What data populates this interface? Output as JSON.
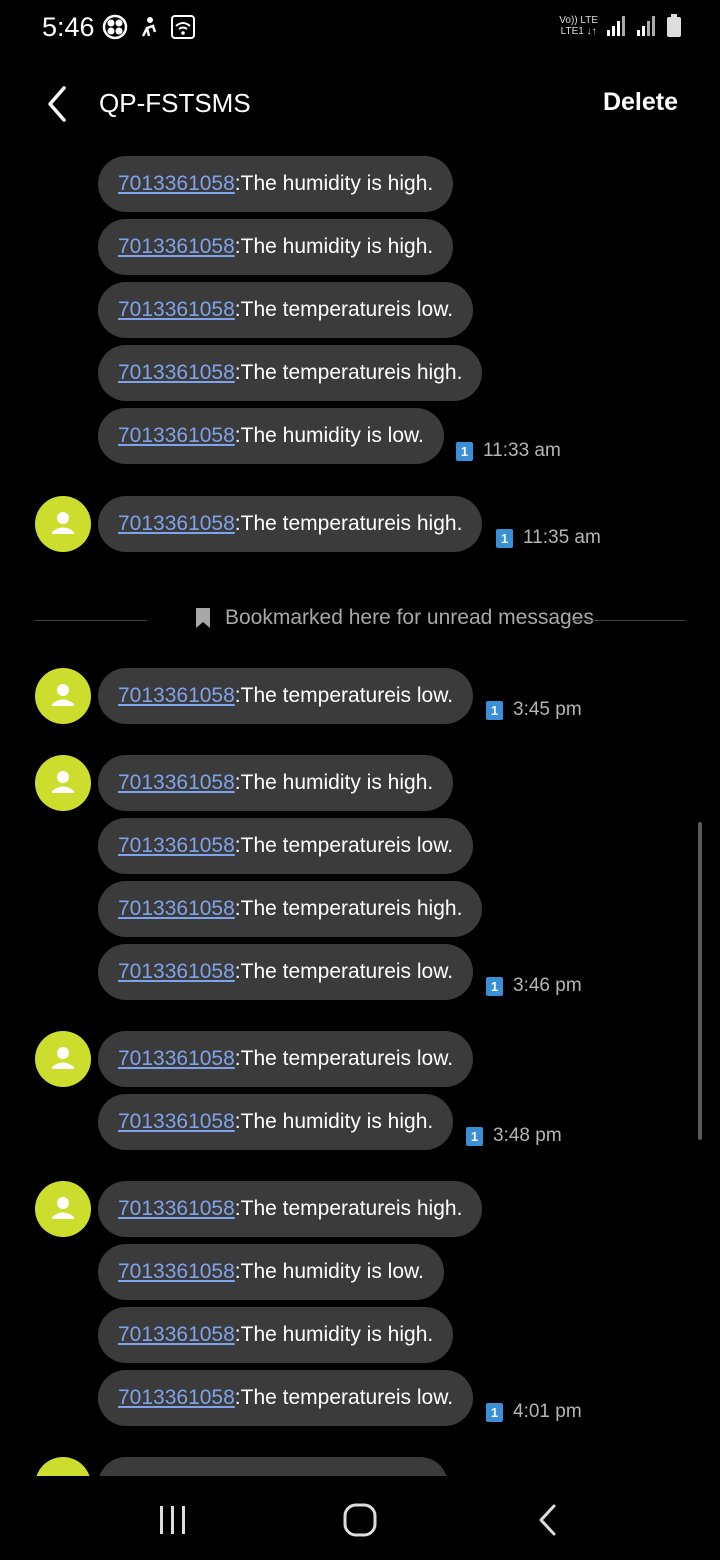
{
  "status_bar": {
    "time": "5:46",
    "network_top": "Vo)) LTE",
    "network_bottom": "LTE1 ↓↑"
  },
  "header": {
    "title": "QP-FSTSMS",
    "delete_label": "Delete"
  },
  "bookmark": {
    "label": "Bookmarked here for unread messages"
  },
  "messages": [
    {
      "number": "7013361058",
      "text": ":The humidity is high."
    },
    {
      "number": "7013361058",
      "text": ":The humidity is high."
    },
    {
      "number": "7013361058",
      "text": ":The temperatureis low."
    },
    {
      "number": "7013361058",
      "text": ":The temperatureis high."
    },
    {
      "number": "7013361058",
      "text": ":The humidity is low.",
      "sim": "1",
      "time": "11:33 am"
    },
    {
      "number": "7013361058",
      "text": ":The temperatureis high.",
      "sim": "1",
      "time": "11:35 am"
    },
    {
      "number": "7013361058",
      "text": ":The temperatureis low.",
      "sim": "1",
      "time": "3:45 pm"
    },
    {
      "number": "7013361058",
      "text": ":The humidity is high."
    },
    {
      "number": "7013361058",
      "text": ":The temperatureis low."
    },
    {
      "number": "7013361058",
      "text": ":The temperatureis high."
    },
    {
      "number": "7013361058",
      "text": ":The temperatureis low.",
      "sim": "1",
      "time": "3:46 pm"
    },
    {
      "number": "7013361058",
      "text": ":The temperatureis low."
    },
    {
      "number": "7013361058",
      "text": ":The humidity is high.",
      "sim": "1",
      "time": "3:48 pm"
    },
    {
      "number": "7013361058",
      "text": ":The temperatureis high."
    },
    {
      "number": "7013361058",
      "text": ":The humidity is low."
    },
    {
      "number": "7013361058",
      "text": ":The humidity is high."
    },
    {
      "number": "7013361058",
      "text": ":The temperatureis low.",
      "sim": "1",
      "time": "4:01 pm"
    }
  ],
  "icons": {
    "back": "chevron-left-icon",
    "avatar": "person-icon",
    "bookmark": "bookmark-icon",
    "sim": "sim1-icon",
    "nav_recents": "recents-icon",
    "nav_home": "home-icon",
    "nav_back": "back-icon"
  },
  "colors": {
    "background": "#000000",
    "bubble": "#3b3b3b",
    "link": "#7fa3ea",
    "avatar": "#cddd2e",
    "sim_badge": "#3a8fd6"
  }
}
